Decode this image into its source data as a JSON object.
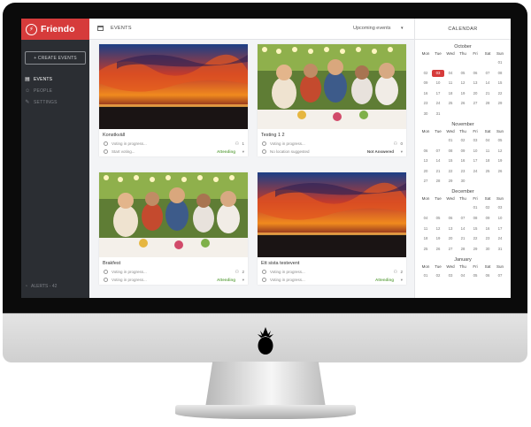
{
  "app": {
    "brand_name": "Friendo",
    "brand_color": "#d63b3b"
  },
  "sidebar": {
    "create_button": "+ CREATE EVENTS",
    "items": [
      {
        "label": "EVENTS",
        "icon": "calendar-icon",
        "active": true
      },
      {
        "label": "PEOPLE",
        "icon": "people-icon",
        "active": false
      },
      {
        "label": "SETTINGS",
        "icon": "wrench-icon",
        "active": false
      }
    ],
    "alerts": "ALERTS - 42"
  },
  "header": {
    "title": "EVENTS",
    "filter_value": "Upcoming events"
  },
  "events": [
    {
      "name": "Konstkväll",
      "row1_text": "Voting in progress...",
      "row1_count": "1",
      "row2_text": "Start voting...",
      "status": "Attending"
    },
    {
      "name": "Testing 1 2",
      "row1_text": "Voting in progress...",
      "row1_count": "0",
      "row2_text": "No location suggested",
      "status": "Not Answered"
    },
    {
      "name": "Brakfest",
      "row1_text": "Voting in progress...",
      "row1_count": "2",
      "row2_text": "Voting in progress...",
      "status": "Attending"
    },
    {
      "name": "Ett sista testevent",
      "row1_text": "Voting in progress...",
      "row1_count": "2",
      "row2_text": "Voting in progress...",
      "status": "Attending"
    }
  ],
  "calendar": {
    "title": "CALENDAR",
    "weekdays": [
      "Mon",
      "Tue",
      "Wed",
      "Thu",
      "Fri",
      "Sat",
      "Sun"
    ],
    "months": [
      {
        "name": "October",
        "lead": 6,
        "days": [
          "01",
          "02",
          "03",
          "04",
          "05",
          "06",
          "07",
          "08",
          "09",
          "10",
          "11",
          "12",
          "13",
          "14",
          "15",
          "16",
          "17",
          "18",
          "19",
          "20",
          "21",
          "22",
          "23",
          "24",
          "25",
          "26",
          "27",
          "28",
          "29",
          "30",
          "31"
        ],
        "today": "03"
      },
      {
        "name": "November",
        "lead": 2,
        "days": [
          "01",
          "02",
          "03",
          "04",
          "05",
          "06",
          "07",
          "08",
          "09",
          "10",
          "11",
          "12",
          "13",
          "14",
          "15",
          "16",
          "17",
          "18",
          "19",
          "20",
          "21",
          "22",
          "23",
          "24",
          "25",
          "26",
          "27",
          "28",
          "29",
          "30"
        ]
      },
      {
        "name": "December",
        "lead": 4,
        "days": [
          "01",
          "02",
          "03",
          "04",
          "05",
          "06",
          "07",
          "08",
          "09",
          "10",
          "11",
          "12",
          "13",
          "14",
          "15",
          "16",
          "17",
          "18",
          "19",
          "20",
          "21",
          "22",
          "23",
          "24",
          "25",
          "26",
          "27",
          "28",
          "29",
          "30",
          "31"
        ]
      },
      {
        "name": "January",
        "lead": 0,
        "days": [
          "01",
          "02",
          "03",
          "04",
          "05",
          "06",
          "07"
        ]
      }
    ]
  }
}
